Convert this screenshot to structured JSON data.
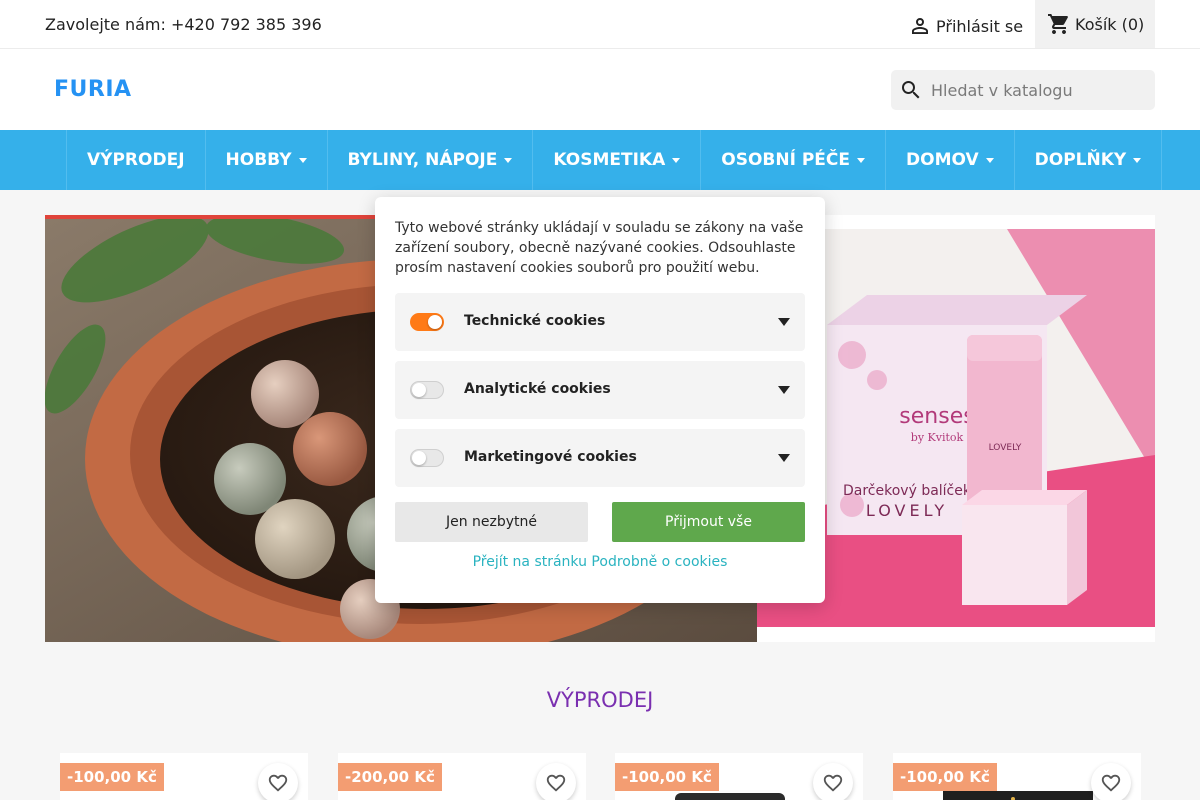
{
  "topbar": {
    "contact": "Zavolejte nám: +420 792 385 396",
    "signin_label": "Přihlásit se",
    "cart_label": "Košík (0)"
  },
  "header": {
    "logo": "FURIA",
    "search_placeholder": "Hledat v katalogu"
  },
  "nav": {
    "items": [
      {
        "label": "VÝPRODEJ",
        "has_dropdown": false
      },
      {
        "label": "HOBBY",
        "has_dropdown": true
      },
      {
        "label": "BYLINY, NÁPOJE",
        "has_dropdown": true
      },
      {
        "label": "KOSMETIKA",
        "has_dropdown": true
      },
      {
        "label": "OSOBNÍ PÉČE",
        "has_dropdown": true
      },
      {
        "label": "DOMOV",
        "has_dropdown": true
      },
      {
        "label": "DOPLŇKY",
        "has_dropdown": true
      }
    ]
  },
  "banner_right": {
    "brand": "senses",
    "brand_sub": "by Kvitok",
    "box_title": "Darčekový balíček",
    "box_name": "LOVELY",
    "jar_label": "LOVELY"
  },
  "section": {
    "title": "VÝPRODEJ"
  },
  "products": [
    {
      "discount": "-100,00 Kč"
    },
    {
      "discount": "-200,00 Kč"
    },
    {
      "discount": "-100,00 Kč"
    },
    {
      "discount": "-100,00 Kč"
    }
  ],
  "cookie": {
    "text": "Tyto webové stránky ukládají v souladu se zákony na vaše zařízení soubory, obecně nazývané cookies. Odsouhlaste prosím nastavení cookies souborů pro použití webu.",
    "categories": [
      {
        "label": "Technické cookies",
        "enabled": true
      },
      {
        "label": "Analytické cookies",
        "enabled": false
      },
      {
        "label": "Marketingové cookies",
        "enabled": false
      }
    ],
    "btn_necessary": "Jen nezbytné",
    "btn_accept": "Přijmout vše",
    "link": "Přejít na stránku Podrobně o cookies"
  },
  "colors": {
    "nav": "#35b0ea",
    "logo": "#2592f3",
    "accept": "#5fa84c",
    "toggle_on": "#ff7a16",
    "discount": "#f39d72",
    "section_title": "#7a2fb0",
    "link": "#2ab3c0"
  },
  "icons": {
    "signin": "person-icon",
    "cart": "shopping-cart-icon",
    "search": "search-icon",
    "wishlist": "heart-outline-icon"
  }
}
